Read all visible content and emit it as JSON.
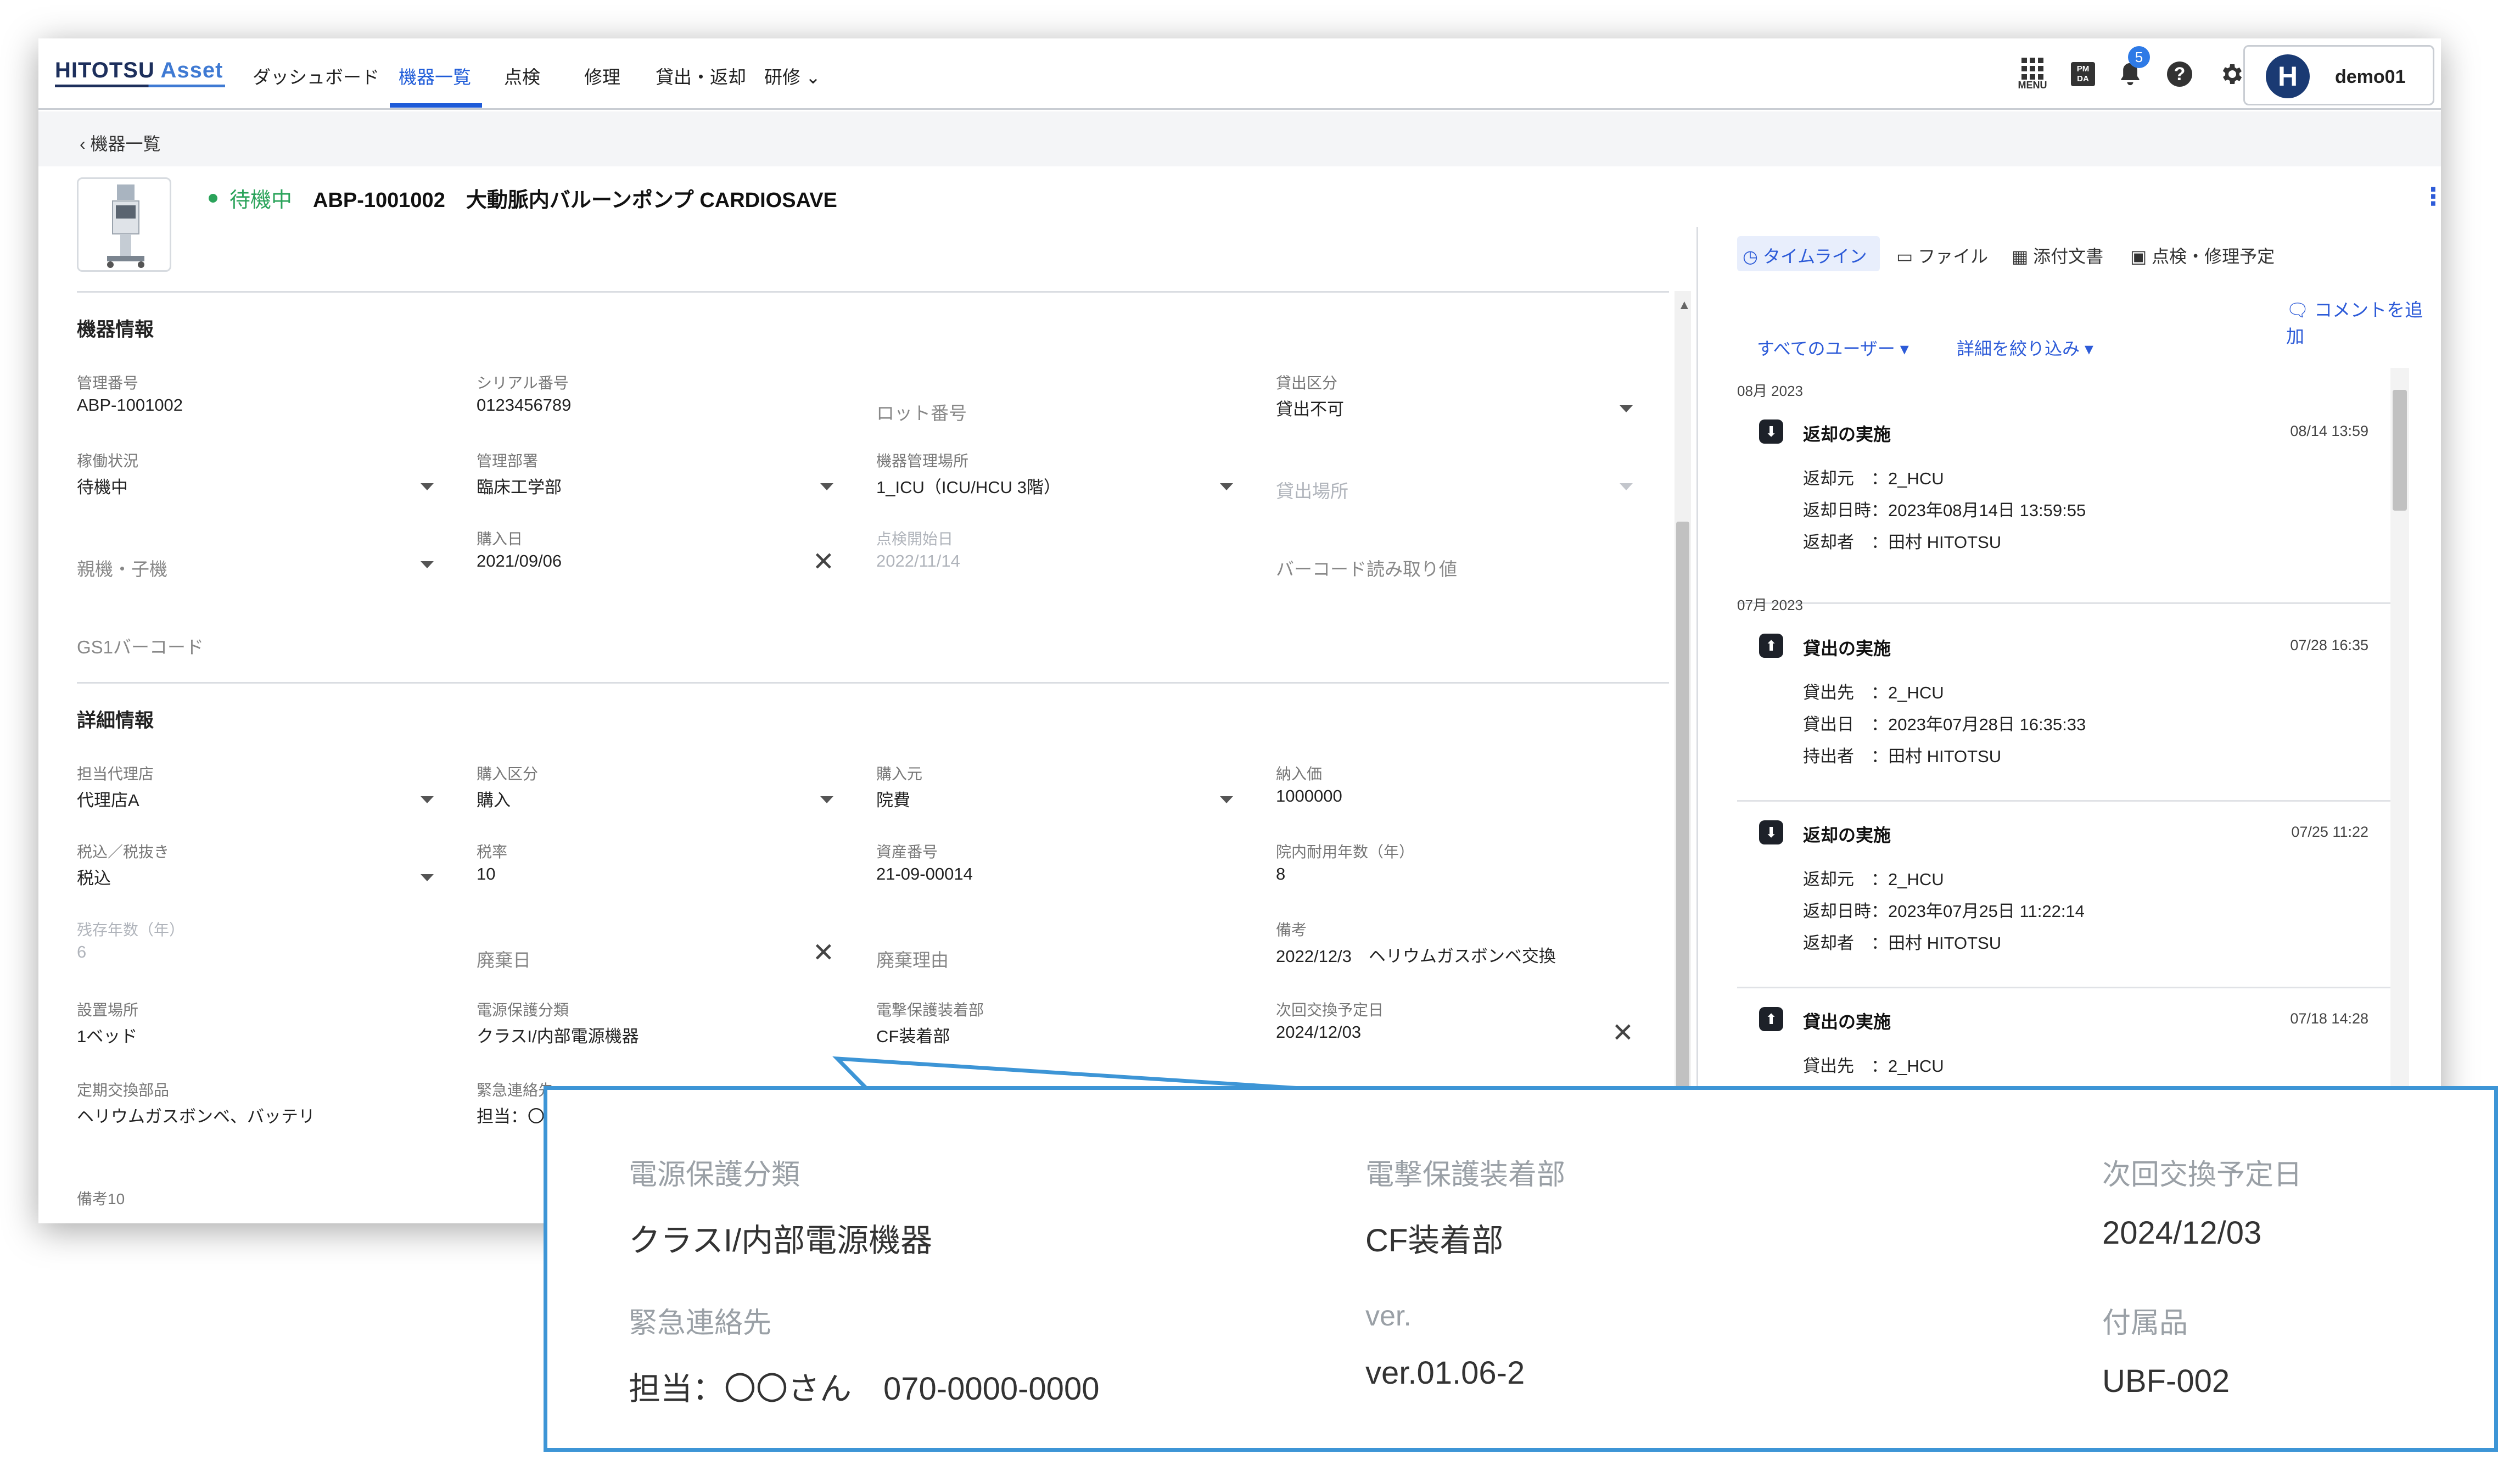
{
  "header": {
    "logo": "HITOTSU",
    "logo_accent": "Asset",
    "nav": [
      "ダッシュボード",
      "機器一覧",
      "点検",
      "修理",
      "貸出・返却",
      "研修"
    ],
    "menu_label": "MENU",
    "pmda_label": "PM DA",
    "notification_count": "5",
    "user_initial": "H",
    "user_name": "demo01"
  },
  "breadcrumb": {
    "back_label": "機器一覧"
  },
  "device": {
    "status": "待機中",
    "title": "ABP-1001002　大動脈内バルーンポンプ CARDIOSAVE"
  },
  "sections": {
    "info": "機器情報",
    "detail": "詳細情報"
  },
  "fields": {
    "kanri_no": {
      "label": "管理番号",
      "value": "ABP-1001002"
    },
    "serial": {
      "label": "シリアル番号",
      "value": "0123456789"
    },
    "lot": {
      "label": "ロット番号"
    },
    "kashidashi_kubun": {
      "label": "貸出区分",
      "value": "貸出不可"
    },
    "kado": {
      "label": "稼働状況",
      "value": "待機中"
    },
    "busho": {
      "label": "管理部署",
      "value": "臨床工学部"
    },
    "basho": {
      "label": "機器管理場所",
      "value": "1_ICU（ICU/HCU 3階）"
    },
    "kashidashi_basho": {
      "label": "貸出場所"
    },
    "oyako": {
      "label": "親機・子機"
    },
    "konyu_bi": {
      "label": "購入日",
      "value": "2021/09/06"
    },
    "tenken_kaishi": {
      "label": "点検開始日",
      "value": "2022/11/14"
    },
    "barcode_read": {
      "label": "バーコード読み取り値"
    },
    "gs1": {
      "label": "GS1バーコード"
    },
    "dairiten": {
      "label": "担当代理店",
      "value": "代理店A"
    },
    "konyu_kubun": {
      "label": "購入区分",
      "value": "購入"
    },
    "konyu_moto": {
      "label": "購入元",
      "value": "院費"
    },
    "nounyu_ka": {
      "label": "納入価",
      "value": "1000000"
    },
    "zeikomi": {
      "label": "税込／税抜き",
      "value": "税込"
    },
    "zeiritsu": {
      "label": "税率",
      "value": "10"
    },
    "shisan_no": {
      "label": "資産番号",
      "value": "21-09-00014"
    },
    "tainen": {
      "label": "院内耐用年数（年）",
      "value": "8"
    },
    "zanzon": {
      "label": "残存年数（年）",
      "value": "6"
    },
    "haiki_bi": {
      "label": "廃棄日"
    },
    "haiki_riyu": {
      "label": "廃棄理由"
    },
    "biko": {
      "label": "備考",
      "value": "2022/12/3　ヘリウムガスボンベ交換"
    },
    "setchi": {
      "label": "設置場所",
      "value": "1ベッド"
    },
    "dengen": {
      "label": "電源保護分類",
      "value": "クラスI/内部電源機器"
    },
    "dengeki": {
      "label": "電撃保護装着部",
      "value": "CF装着部"
    },
    "koukan": {
      "label": "次回交換予定日",
      "value": "2024/12/03"
    },
    "teiki": {
      "label": "定期交換部品",
      "value": "ヘリウムガスボンベ、バッテリ"
    },
    "kinkyu": {
      "label": "緊急連絡先",
      "value": "担当：〇"
    },
    "biko10": {
      "label": "備考10"
    }
  },
  "side": {
    "tabs": [
      "タイムライン",
      "ファイル",
      "添付文書",
      "点検・修理予定"
    ],
    "add_comment": "コメントを追加",
    "filter_users": "すべてのユーザー",
    "filter_detail": "詳細を絞り込み",
    "months": [
      "08月 2023",
      "07月 2023"
    ],
    "events": [
      {
        "title": "返却の実施",
        "time": "08/14 13:59",
        "rows": [
          "返却元　：2_HCU",
          "返却日時：2023年08月14日 13:59:55",
          "返却者　：田村 HITOTSU"
        ]
      },
      {
        "title": "貸出の実施",
        "time": "07/28 16:35",
        "rows": [
          "貸出先　：2_HCU",
          "貸出日　：2023年07月28日 16:35:33",
          "持出者　：田村 HITOTSU"
        ]
      },
      {
        "title": "返却の実施",
        "time": "07/25 11:22",
        "rows": [
          "返却元　：2_HCU",
          "返却日時：2023年07月25日 11:22:14",
          "返却者　：田村 HITOTSU"
        ]
      },
      {
        "title": "貸出の実施",
        "time": "07/18 14:28",
        "rows": [
          "貸出先　：2_HCU"
        ]
      }
    ]
  },
  "callout": {
    "dengen_label": "電源保護分類",
    "dengen_value": "クラスI/内部電源機器",
    "dengeki_label": "電撃保護装着部",
    "dengeki_value": "CF装着部",
    "koukan_label": "次回交換予定日",
    "koukan_value": "2024/12/03",
    "kinkyu_label": "緊急連絡先",
    "kinkyu_value": "担当：〇〇さん　070-0000-0000",
    "ver_label": "ver.",
    "ver_value": "ver.01.06-2",
    "fuzoku_label": "付属品",
    "fuzoku_value": "UBF-002"
  }
}
